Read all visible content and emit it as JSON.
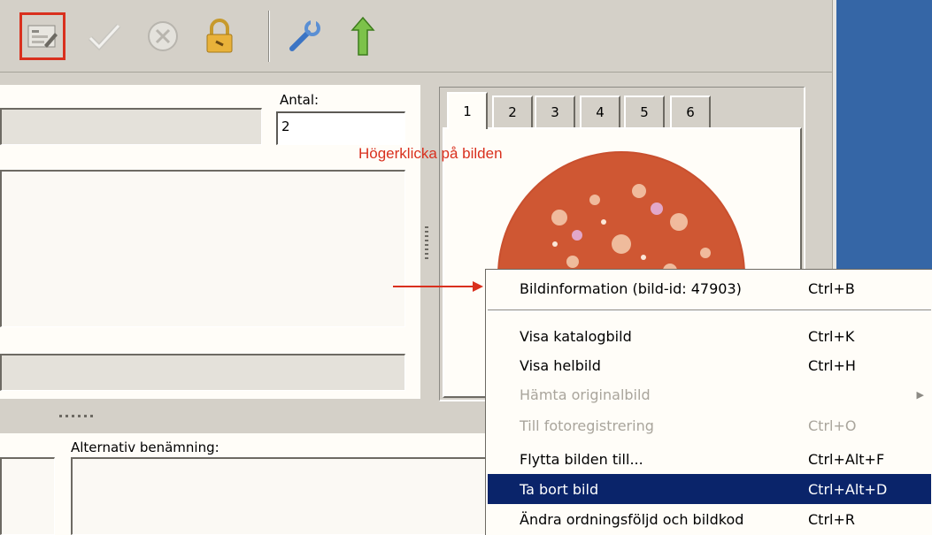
{
  "toolbar": {
    "buttons": [
      {
        "icon": "edit-form-icon",
        "active": true
      },
      {
        "icon": "checkmark-icon",
        "active": false
      },
      {
        "icon": "cancel-icon",
        "active": false
      },
      {
        "icon": "lock-icon",
        "active": false
      },
      {
        "icon": "wrench-icon",
        "active": false
      },
      {
        "icon": "up-arrow-icon",
        "active": false
      }
    ]
  },
  "form": {
    "antal_label": "Antal:",
    "antal_value": "2",
    "alt_label": "Alternativ benämning:"
  },
  "image_panel": {
    "tabs": [
      "1",
      "2",
      "3",
      "4",
      "5",
      "6"
    ],
    "active_tab": "1",
    "hint": "Högerklicka på bilden"
  },
  "context_menu": {
    "items": [
      {
        "label": "Bildinformation (bild-id: 47903)",
        "shortcut": "Ctrl+B",
        "enabled": true
      },
      {
        "label": "Visa katalogbild",
        "shortcut": "Ctrl+K",
        "enabled": true
      },
      {
        "label": "Visa helbild",
        "shortcut": "Ctrl+H",
        "enabled": true
      },
      {
        "label": "Hämta originalbild",
        "shortcut": "",
        "enabled": false,
        "submenu": true
      },
      {
        "label": "Till fotoregistrering",
        "shortcut": "Ctrl+O",
        "enabled": false
      },
      {
        "label": "Flytta bilden till...",
        "shortcut": "Ctrl+Alt+F",
        "enabled": true
      },
      {
        "label": "Ta bort bild",
        "shortcut": "Ctrl+Alt+D",
        "enabled": true,
        "highlighted": true
      },
      {
        "label": "Ändra ordningsföljd och bildkod",
        "shortcut": "Ctrl+R",
        "enabled": true
      }
    ]
  },
  "colors": {
    "highlight": "#0a246a",
    "annotation": "#d9301e",
    "side_panel": "#3566a6",
    "window_bg": "#d4d0c8"
  }
}
